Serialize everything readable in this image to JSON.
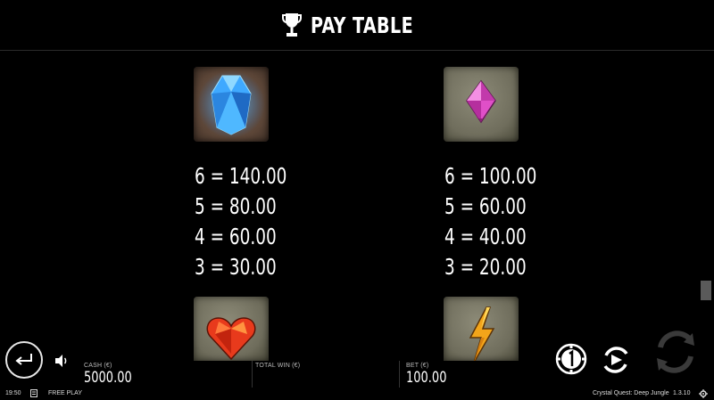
{
  "header": {
    "title": "PAY TABLE",
    "icon": "trophy-icon"
  },
  "symbols": [
    {
      "name": "blue-crystal",
      "tile": "wood",
      "color": "#3fa9ff",
      "payouts": [
        "6 = 140.00",
        "5 = 80.00",
        "4 = 60.00",
        "3 = 30.00"
      ]
    },
    {
      "name": "pink-gem",
      "tile": "stone",
      "color": "#e04fc8",
      "payouts": [
        "6 = 100.00",
        "5 = 60.00",
        "4 = 40.00",
        "3 = 20.00"
      ]
    },
    {
      "name": "red-heart-gem",
      "tile": "stone",
      "color": "#e83a1c"
    },
    {
      "name": "orange-bolt-gem",
      "tile": "stone",
      "color": "#f3a51a"
    }
  ],
  "bottom_bar": {
    "cash_label": "CASH (€)",
    "cash_value": "5000.00",
    "total_win_label": "TOTAL WIN (€)",
    "bet_label": "BET (€)",
    "bet_value": "100.00"
  },
  "footer": {
    "time": "19:50",
    "mode": "FREE PLAY",
    "game_name": "Crystal Quest: Deep Jungle",
    "version": "1.3.10"
  },
  "scroll": {
    "position_fraction": 0.75
  }
}
